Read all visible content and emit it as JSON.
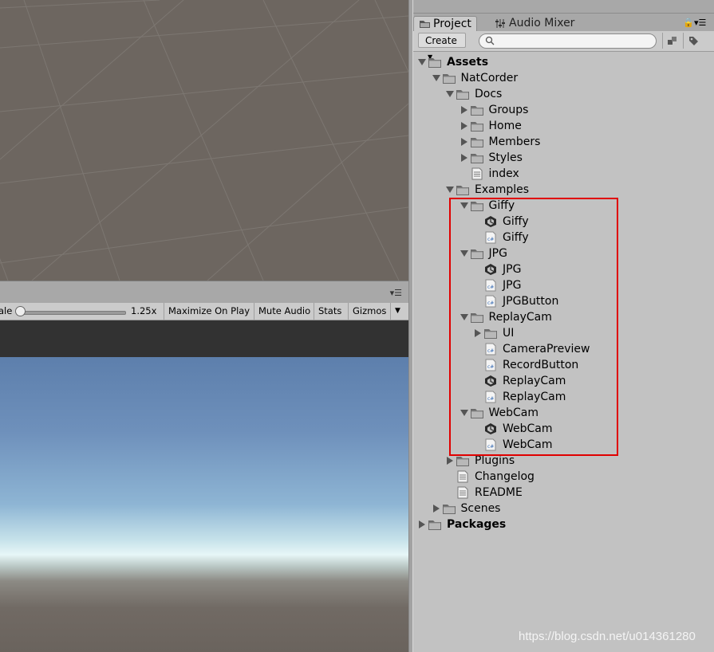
{
  "scene": {},
  "game": {
    "scale_label": "ale",
    "scale_value": "1.25x",
    "toolbar": [
      "Maximize On Play",
      "Mute Audio",
      "Stats",
      "Gizmos"
    ]
  },
  "project": {
    "tabs": [
      {
        "label": "Project",
        "icon": "folder-icon"
      },
      {
        "label": "Audio Mixer",
        "icon": "mixer-icon"
      }
    ],
    "create_label": "Create",
    "search_placeholder": "",
    "tree": [
      {
        "label": "Assets",
        "icon": "folder",
        "arrow": "open",
        "bold": true
      },
      {
        "label": "NatCorder",
        "icon": "folder",
        "arrow": "open"
      },
      {
        "label": "Docs",
        "icon": "folder",
        "arrow": "open"
      },
      {
        "label": "Groups",
        "icon": "folder",
        "arrow": "closed"
      },
      {
        "label": "Home",
        "icon": "folder",
        "arrow": "closed"
      },
      {
        "label": "Members",
        "icon": "folder",
        "arrow": "closed"
      },
      {
        "label": "Styles",
        "icon": "folder",
        "arrow": "closed"
      },
      {
        "label": "index",
        "icon": "text"
      },
      {
        "label": "Examples",
        "icon": "folder",
        "arrow": "open"
      },
      {
        "label": "Giffy",
        "icon": "folder",
        "arrow": "open"
      },
      {
        "label": "Giffy",
        "icon": "unity"
      },
      {
        "label": "Giffy",
        "icon": "script"
      },
      {
        "label": "JPG",
        "icon": "folder",
        "arrow": "open"
      },
      {
        "label": "JPG",
        "icon": "unity"
      },
      {
        "label": "JPG",
        "icon": "script"
      },
      {
        "label": "JPGButton",
        "icon": "script"
      },
      {
        "label": "ReplayCam",
        "icon": "folder",
        "arrow": "open"
      },
      {
        "label": "UI",
        "icon": "folder",
        "arrow": "closed"
      },
      {
        "label": "CameraPreview",
        "icon": "script"
      },
      {
        "label": "RecordButton",
        "icon": "script"
      },
      {
        "label": "ReplayCam",
        "icon": "unity"
      },
      {
        "label": "ReplayCam",
        "icon": "script"
      },
      {
        "label": "WebCam",
        "icon": "folder",
        "arrow": "open"
      },
      {
        "label": "WebCam",
        "icon": "unity"
      },
      {
        "label": "WebCam",
        "icon": "script"
      },
      {
        "label": "Plugins",
        "icon": "folder",
        "arrow": "closed"
      },
      {
        "label": "Changelog",
        "icon": "text"
      },
      {
        "label": "README",
        "icon": "text"
      },
      {
        "label": "Scenes",
        "icon": "folder",
        "arrow": "closed"
      },
      {
        "label": "Packages",
        "icon": "folder",
        "arrow": "closed",
        "bold": true
      }
    ]
  },
  "watermark": "https://blog.csdn.net/u014361280"
}
